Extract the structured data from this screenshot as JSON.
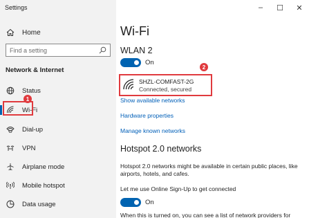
{
  "window": {
    "title": "Settings",
    "minimize": "–",
    "maximize": "☐",
    "close": "✕"
  },
  "sidebar": {
    "home": "Home",
    "search_placeholder": "Find a setting",
    "section": "Network & Internet",
    "items": [
      {
        "label": "Status",
        "icon": "globe-icon"
      },
      {
        "label": "Wi-Fi",
        "icon": "wifi-icon",
        "selected": true
      },
      {
        "label": "Dial-up",
        "icon": "dialup-icon"
      },
      {
        "label": "VPN",
        "icon": "vpn-icon"
      },
      {
        "label": "Airplane mode",
        "icon": "airplane-icon"
      },
      {
        "label": "Mobile hotspot",
        "icon": "hotspot-icon"
      },
      {
        "label": "Data usage",
        "icon": "data-usage-icon"
      }
    ]
  },
  "main": {
    "title": "Wi-Fi",
    "adapter": "WLAN 2",
    "wifi_toggle": "On",
    "network": {
      "name": "SHZL-COMFAST-2G",
      "status": "Connected, secured"
    },
    "links": [
      "Show available networks",
      "Hardware properties",
      "Manage known networks"
    ],
    "hotspot_title": "Hotspot 2.0 networks",
    "hotspot_desc": "Hotspot 2.0 networks might be available in certain public places, like airports, hotels, and cafes.",
    "signup_label": "Let me use Online Sign-Up to get connected",
    "signup_toggle": "On",
    "bottom_text": "When this is turned on, you can see a list of network providers for"
  },
  "annotations": {
    "badge1": "1",
    "badge2": "2"
  },
  "colors": {
    "accent": "#0063b1",
    "highlight": "#e03a3e",
    "link": "#005fb8",
    "sidebar_bg": "#f2f2f2"
  }
}
